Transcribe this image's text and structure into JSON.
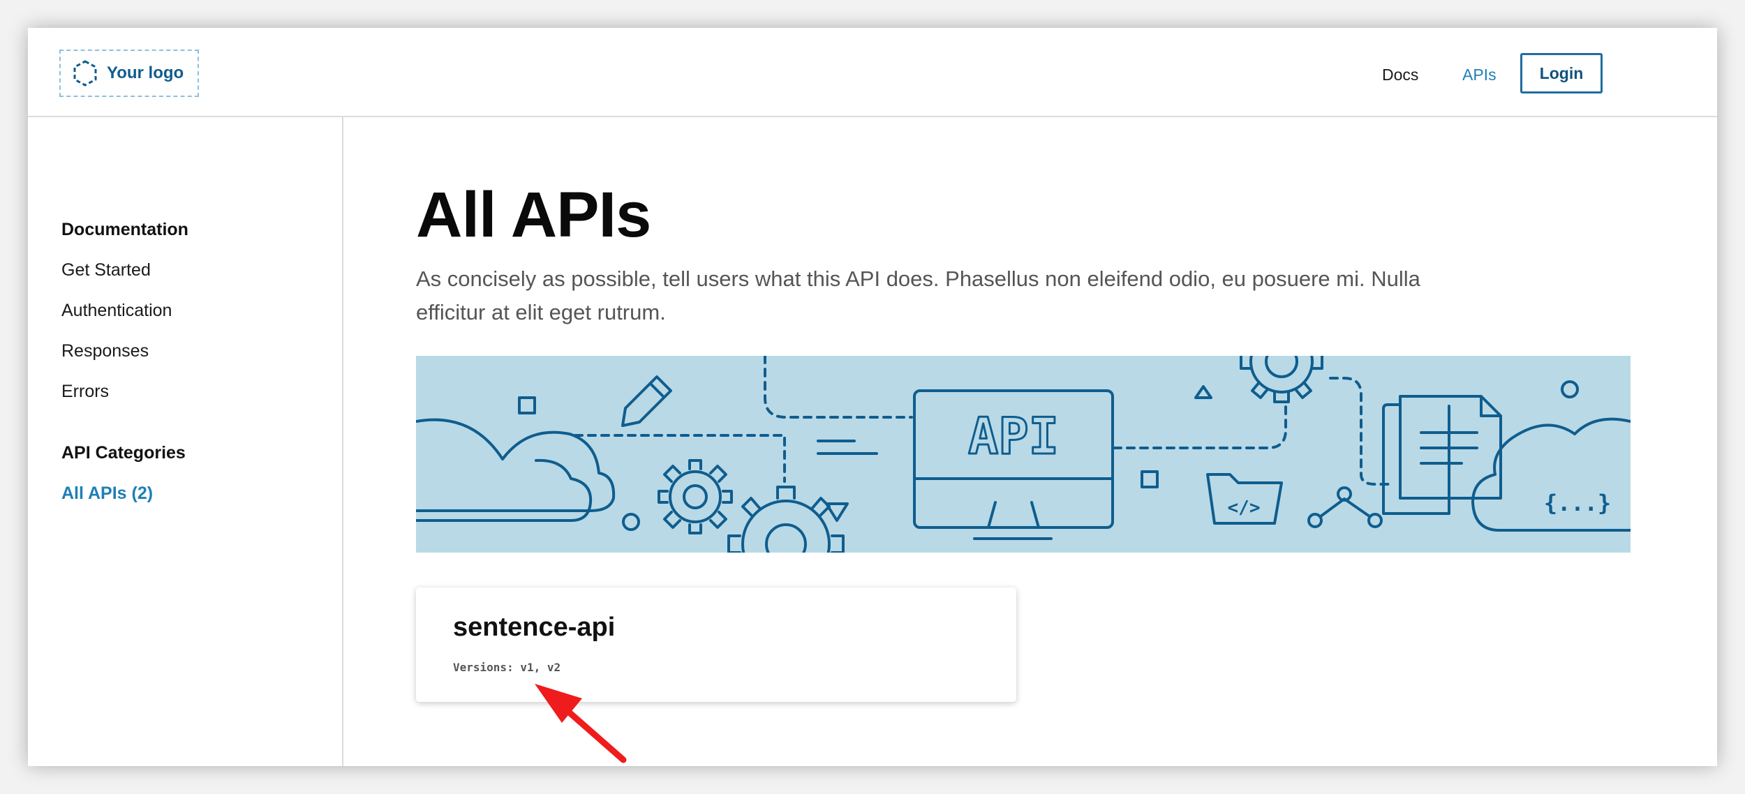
{
  "header": {
    "logo_text": "Your logo",
    "nav": {
      "docs": "Docs",
      "apis": "APIs"
    },
    "login_label": "Login"
  },
  "sidebar": {
    "documentation_heading": "Documentation",
    "doc_links": [
      "Get Started",
      "Authentication",
      "Responses",
      "Errors"
    ],
    "categories_heading": "API Categories",
    "category_links": [
      "All APIs (2)"
    ]
  },
  "main": {
    "title": "All APIs",
    "intro": "As concisely as possible, tell users what this API does. Phasellus non eleifend odio, eu posuere mi. Nulla efficitur at elit eget rutrum.",
    "banner": {
      "monitor_label": "API",
      "folder_label": "</>",
      "braces_label": "{...}"
    },
    "cards": [
      {
        "name": "sentence-api",
        "versions": "Versions: v1, v2"
      }
    ]
  },
  "colors": {
    "accent": "#1f7fb5",
    "banner_bg": "#b9d9e6",
    "banner_line": "#0f5d8e",
    "annotation_arrow": "#ee1c1c"
  }
}
